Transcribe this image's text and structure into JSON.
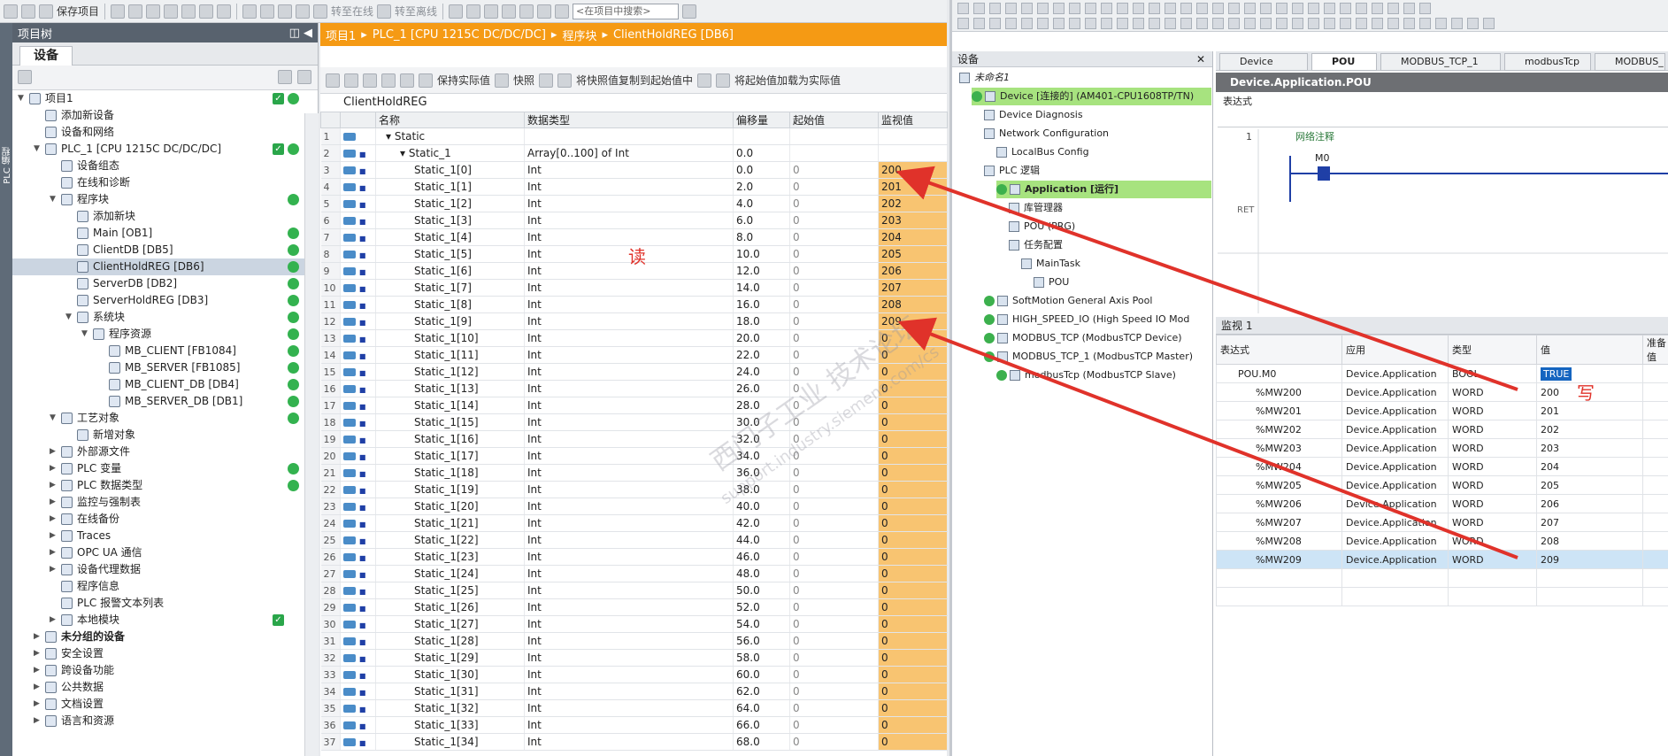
{
  "toolbar": {
    "save_project": "保存项目",
    "go_online": "转至在线",
    "go_offline": "转至离线",
    "search_placeholder": "<在项目中搜索>"
  },
  "side_strip": {
    "label": "PLC 编程"
  },
  "project_tree": {
    "title": "项目树",
    "tab": "设备",
    "items": [
      {
        "label": "项目1",
        "status": "check"
      },
      {
        "label": "添加新设备"
      },
      {
        "label": "设备和网络"
      },
      {
        "label": "PLC_1 [CPU 1215C DC/DC/DC]",
        "status": "check"
      },
      {
        "label": "设备组态"
      },
      {
        "label": "在线和诊断"
      },
      {
        "label": "程序块",
        "status": "dot"
      },
      {
        "label": "添加新块"
      },
      {
        "label": "Main [OB1]",
        "status": "dot"
      },
      {
        "label": "ClientDB [DB5]",
        "status": "dot"
      },
      {
        "label": "ClientHoldREG [DB6]",
        "status": "dot"
      },
      {
        "label": "ServerDB [DB2]",
        "status": "dot"
      },
      {
        "label": "ServerHoldREG [DB3]",
        "status": "dot"
      },
      {
        "label": "系统块",
        "status": "dot"
      },
      {
        "label": "程序资源",
        "status": "dot"
      },
      {
        "label": "MB_CLIENT [FB1084]",
        "status": "dot"
      },
      {
        "label": "MB_SERVER [FB1085]",
        "status": "dot"
      },
      {
        "label": "MB_CLIENT_DB [DB4]",
        "status": "dot"
      },
      {
        "label": "MB_SERVER_DB [DB1]",
        "status": "dot"
      },
      {
        "label": "工艺对象",
        "status": "dot"
      },
      {
        "label": "新增对象"
      },
      {
        "label": "外部源文件"
      },
      {
        "label": "PLC 变量",
        "status": "dot"
      },
      {
        "label": "PLC 数据类型",
        "status": "dot"
      },
      {
        "label": "监控与强制表"
      },
      {
        "label": "在线备份"
      },
      {
        "label": "Traces"
      },
      {
        "label": "OPC UA 通信"
      },
      {
        "label": "设备代理数据"
      },
      {
        "label": "程序信息"
      },
      {
        "label": "PLC 报警文本列表"
      },
      {
        "label": "本地模块",
        "status": "check"
      },
      {
        "label": "未分组的设备"
      },
      {
        "label": "安全设置"
      },
      {
        "label": "跨设备功能"
      },
      {
        "label": "公共数据"
      },
      {
        "label": "文档设置"
      },
      {
        "label": "语言和资源"
      }
    ]
  },
  "editor": {
    "breadcrumb": [
      "项目1",
      "PLC_1 [CPU 1215C DC/DC/DC]",
      "程序块",
      "ClientHoldREG [DB6]"
    ],
    "toolbar": {
      "keep_actual": "保持实际值",
      "snapshot": "快照",
      "copy_snapshot": "将快照值复制到起始值中",
      "load_start": "将起始值加载为实际值"
    },
    "db_name": "ClientHoldREG",
    "columns": [
      "名称",
      "数据类型",
      "偏移量",
      "起始值",
      "监视值"
    ],
    "rows": [
      {
        "n": "1",
        "name": "Static",
        "type": "",
        "off": "",
        "start": "",
        "mon": "",
        "lvl": 0,
        "exp": true
      },
      {
        "n": "2",
        "name": "Static_1",
        "type": "Array[0..100] of Int",
        "off": "0.0",
        "start": "",
        "mon": "",
        "lvl": 1,
        "exp": true
      },
      {
        "n": "3",
        "name": "Static_1[0]",
        "type": "Int",
        "off": "0.0",
        "start": "0",
        "mon": "200",
        "lvl": 2
      },
      {
        "n": "4",
        "name": "Static_1[1]",
        "type": "Int",
        "off": "2.0",
        "start": "0",
        "mon": "201",
        "lvl": 2
      },
      {
        "n": "5",
        "name": "Static_1[2]",
        "type": "Int",
        "off": "4.0",
        "start": "0",
        "mon": "202",
        "lvl": 2
      },
      {
        "n": "6",
        "name": "Static_1[3]",
        "type": "Int",
        "off": "6.0",
        "start": "0",
        "mon": "203",
        "lvl": 2
      },
      {
        "n": "7",
        "name": "Static_1[4]",
        "type": "Int",
        "off": "8.0",
        "start": "0",
        "mon": "204",
        "lvl": 2
      },
      {
        "n": "8",
        "name": "Static_1[5]",
        "type": "Int",
        "off": "10.0",
        "start": "0",
        "mon": "205",
        "lvl": 2
      },
      {
        "n": "9",
        "name": "Static_1[6]",
        "type": "Int",
        "off": "12.0",
        "start": "0",
        "mon": "206",
        "lvl": 2
      },
      {
        "n": "10",
        "name": "Static_1[7]",
        "type": "Int",
        "off": "14.0",
        "start": "0",
        "mon": "207",
        "lvl": 2
      },
      {
        "n": "11",
        "name": "Static_1[8]",
        "type": "Int",
        "off": "16.0",
        "start": "0",
        "mon": "208",
        "lvl": 2
      },
      {
        "n": "12",
        "name": "Static_1[9]",
        "type": "Int",
        "off": "18.0",
        "start": "0",
        "mon": "209",
        "lvl": 2
      },
      {
        "n": "13",
        "name": "Static_1[10]",
        "type": "Int",
        "off": "20.0",
        "start": "0",
        "mon": "0",
        "lvl": 2
      },
      {
        "n": "14",
        "name": "Static_1[11]",
        "type": "Int",
        "off": "22.0",
        "start": "0",
        "mon": "0",
        "lvl": 2
      },
      {
        "n": "15",
        "name": "Static_1[12]",
        "type": "Int",
        "off": "24.0",
        "start": "0",
        "mon": "0",
        "lvl": 2
      },
      {
        "n": "16",
        "name": "Static_1[13]",
        "type": "Int",
        "off": "26.0",
        "start": "0",
        "mon": "0",
        "lvl": 2
      },
      {
        "n": "17",
        "name": "Static_1[14]",
        "type": "Int",
        "off": "28.0",
        "start": "0",
        "mon": "0",
        "lvl": 2
      },
      {
        "n": "18",
        "name": "Static_1[15]",
        "type": "Int",
        "off": "30.0",
        "start": "0",
        "mon": "0",
        "lvl": 2
      },
      {
        "n": "19",
        "name": "Static_1[16]",
        "type": "Int",
        "off": "32.0",
        "start": "0",
        "mon": "0",
        "lvl": 2
      },
      {
        "n": "20",
        "name": "Static_1[17]",
        "type": "Int",
        "off": "34.0",
        "start": "0",
        "mon": "0",
        "lvl": 2
      },
      {
        "n": "21",
        "name": "Static_1[18]",
        "type": "Int",
        "off": "36.0",
        "start": "0",
        "mon": "0",
        "lvl": 2
      },
      {
        "n": "22",
        "name": "Static_1[19]",
        "type": "Int",
        "off": "38.0",
        "start": "0",
        "mon": "0",
        "lvl": 2
      },
      {
        "n": "23",
        "name": "Static_1[20]",
        "type": "Int",
        "off": "40.0",
        "start": "0",
        "mon": "0",
        "lvl": 2
      },
      {
        "n": "24",
        "name": "Static_1[21]",
        "type": "Int",
        "off": "42.0",
        "start": "0",
        "mon": "0",
        "lvl": 2
      },
      {
        "n": "25",
        "name": "Static_1[22]",
        "type": "Int",
        "off": "44.0",
        "start": "0",
        "mon": "0",
        "lvl": 2
      },
      {
        "n": "26",
        "name": "Static_1[23]",
        "type": "Int",
        "off": "46.0",
        "start": "0",
        "mon": "0",
        "lvl": 2
      },
      {
        "n": "27",
        "name": "Static_1[24]",
        "type": "Int",
        "off": "48.0",
        "start": "0",
        "mon": "0",
        "lvl": 2
      },
      {
        "n": "28",
        "name": "Static_1[25]",
        "type": "Int",
        "off": "50.0",
        "start": "0",
        "mon": "0",
        "lvl": 2
      },
      {
        "n": "29",
        "name": "Static_1[26]",
        "type": "Int",
        "off": "52.0",
        "start": "0",
        "mon": "0",
        "lvl": 2
      },
      {
        "n": "30",
        "name": "Static_1[27]",
        "type": "Int",
        "off": "54.0",
        "start": "0",
        "mon": "0",
        "lvl": 2
      },
      {
        "n": "31",
        "name": "Static_1[28]",
        "type": "Int",
        "off": "56.0",
        "start": "0",
        "mon": "0",
        "lvl": 2
      },
      {
        "n": "32",
        "name": "Static_1[29]",
        "type": "Int",
        "off": "58.0",
        "start": "0",
        "mon": "0",
        "lvl": 2
      },
      {
        "n": "33",
        "name": "Static_1[30]",
        "type": "Int",
        "off": "60.0",
        "start": "0",
        "mon": "0",
        "lvl": 2
      },
      {
        "n": "34",
        "name": "Static_1[31]",
        "type": "Int",
        "off": "62.0",
        "start": "0",
        "mon": "0",
        "lvl": 2
      },
      {
        "n": "35",
        "name": "Static_1[32]",
        "type": "Int",
        "off": "64.0",
        "start": "0",
        "mon": "0",
        "lvl": 2
      },
      {
        "n": "36",
        "name": "Static_1[33]",
        "type": "Int",
        "off": "66.0",
        "start": "0",
        "mon": "0",
        "lvl": 2
      },
      {
        "n": "37",
        "name": "Static_1[34]",
        "type": "Int",
        "off": "68.0",
        "start": "0",
        "mon": "0",
        "lvl": 2
      }
    ]
  },
  "codesys": {
    "devices_header": "设备",
    "tree": [
      {
        "label": "未命名1",
        "lvl": 0
      },
      {
        "label": "Device [连接的] (AM401-CPU1608TP/TN)",
        "lvl": 1,
        "green": true,
        "ok": true
      },
      {
        "label": "Device Diagnosis",
        "lvl": 2
      },
      {
        "label": "Network Configuration",
        "lvl": 2
      },
      {
        "label": "LocalBus Config",
        "lvl": 3
      },
      {
        "label": "PLC 逻辑",
        "lvl": 2
      },
      {
        "label": "Application [运行]",
        "lvl": 3,
        "green": true,
        "ok": true,
        "bold": true
      },
      {
        "label": "库管理器",
        "lvl": 4
      },
      {
        "label": "POU (PRG)",
        "lvl": 4
      },
      {
        "label": "任务配置",
        "lvl": 4
      },
      {
        "label": "MainTask",
        "lvl": 5
      },
      {
        "label": "POU",
        "lvl": 6
      },
      {
        "label": "SoftMotion General Axis Pool",
        "lvl": 2,
        "ok": true
      },
      {
        "label": "HIGH_SPEED_IO (High Speed IO Mod",
        "lvl": 2,
        "ok": true
      },
      {
        "label": "MODBUS_TCP (ModbusTCP Device)",
        "lvl": 2,
        "ok": true
      },
      {
        "label": "MODBUS_TCP_1 (ModbusTCP Master)",
        "lvl": 2,
        "ok": true
      },
      {
        "label": "modbusTcp (ModbusTCP Slave)",
        "lvl": 3,
        "ok": true
      }
    ],
    "tabs": [
      "Device",
      "POU",
      "MODBUS_TCP_1",
      "modbusTcp",
      "MODBUS_"
    ],
    "pou_title": "Device.Application.POU",
    "expr_label": "表达式",
    "ladder": {
      "rung_no": "1",
      "comment": "网络注释",
      "contact": "M0",
      "ret": "RET"
    },
    "watch": {
      "title": "监视 1",
      "columns": [
        "表达式",
        "应用",
        "类型",
        "值",
        "准备值"
      ],
      "rows": [
        {
          "expr": "POU.M0",
          "app": "Device.Application",
          "type": "BOOL",
          "val": "TRUE"
        },
        {
          "expr": "%MW200",
          "app": "Device.Application",
          "type": "WORD",
          "val": "200"
        },
        {
          "expr": "%MW201",
          "app": "Device.Application",
          "type": "WORD",
          "val": "201"
        },
        {
          "expr": "%MW202",
          "app": "Device.Application",
          "type": "WORD",
          "val": "202"
        },
        {
          "expr": "%MW203",
          "app": "Device.Application",
          "type": "WORD",
          "val": "203"
        },
        {
          "expr": "%MW204",
          "app": "Device.Application",
          "type": "WORD",
          "val": "204"
        },
        {
          "expr": "%MW205",
          "app": "Device.Application",
          "type": "WORD",
          "val": "205"
        },
        {
          "expr": "%MW206",
          "app": "Device.Application",
          "type": "WORD",
          "val": "206"
        },
        {
          "expr": "%MW207",
          "app": "Device.Application",
          "type": "WORD",
          "val": "207"
        },
        {
          "expr": "%MW208",
          "app": "Device.Application",
          "type": "WORD",
          "val": "208"
        },
        {
          "expr": "%MW209",
          "app": "Device.Application",
          "type": "WORD",
          "val": "209"
        }
      ]
    }
  },
  "annotations": {
    "read": "读",
    "write": "写"
  },
  "watermark": {
    "line1": "西门子工业 技术论坛",
    "line2": "support.industry.siemens.com/cs"
  },
  "colors": {
    "accent_orange": "#f59a14",
    "monitor_cell": "#f8c471",
    "arrow_red": "#e0322a",
    "status_green": "#33b24f",
    "device_green": "#a7e37f"
  }
}
